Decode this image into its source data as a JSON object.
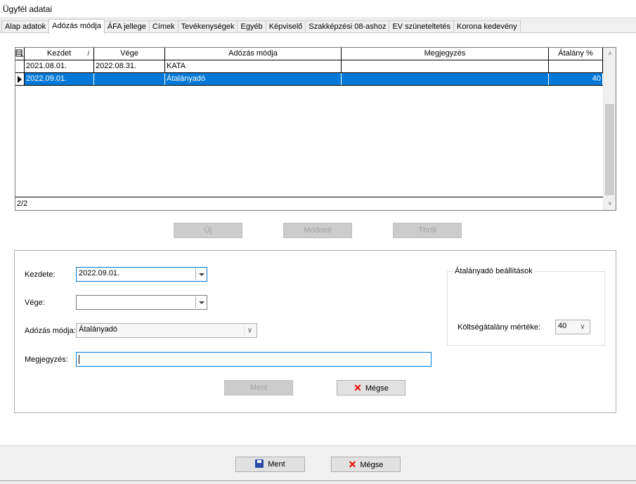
{
  "window": {
    "title": "Ügyfél adatai"
  },
  "tabs": [
    {
      "label": "Alap adatok"
    },
    {
      "label": "Adózás módja",
      "active": true
    },
    {
      "label": "ÁFA jellege"
    },
    {
      "label": "Címek"
    },
    {
      "label": "Tevékenységek"
    },
    {
      "label": "Egyéb"
    },
    {
      "label": "Képviselő"
    },
    {
      "label": "Szakképzési 08-ashoz"
    },
    {
      "label": "EV szüneteltetés"
    },
    {
      "label": "Korona kedevény"
    }
  ],
  "grid": {
    "columns": [
      "Kezdet",
      "Vége",
      "Adózás módja",
      "Megjegyzés",
      "Átalány %"
    ],
    "sort_indicator": "/",
    "rows": [
      {
        "kezdet": "2021.08.01.",
        "vege": "2022.08.31.",
        "mod": "KATA",
        "megjegyzes": "",
        "atalany": ""
      },
      {
        "kezdet": "2022.09.01.",
        "vege": "",
        "mod": "Átalányadó",
        "megjegyzes": "",
        "atalany": "40",
        "selected": true
      }
    ],
    "footer": "2/2"
  },
  "grid_buttons": {
    "new": "Új",
    "modify": "Módosít",
    "delete": "Töröl"
  },
  "form": {
    "kezdete_label": "Kezdete:",
    "kezdete_value": "2022.09.01.",
    "vege_label": "Vége:",
    "vege_value": "",
    "mod_label": "Adózás módja:",
    "mod_value": "Átalányadó",
    "megjegyzes_label": "Megjegyzés:",
    "megjegyzes_value": "",
    "save": "Ment",
    "cancel": "Mégse"
  },
  "atalany_settings": {
    "title": "Átalányadó beállítások",
    "koltseg_label": "Költségátalány mértéke:",
    "koltseg_value": "40"
  },
  "bottom": {
    "save": "Ment",
    "cancel": "Mégse"
  }
}
